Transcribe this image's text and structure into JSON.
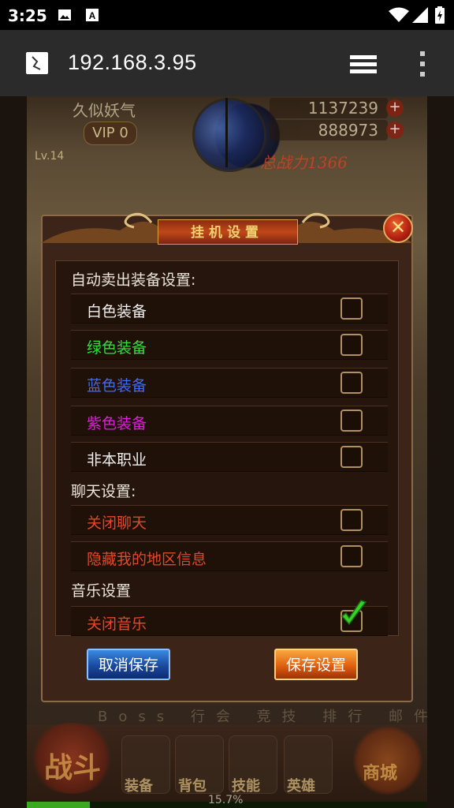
{
  "status_bar": {
    "time": "3:25",
    "icons": [
      "image-icon",
      "font-icon",
      "wifi-icon",
      "signal-icon",
      "battery-icon"
    ]
  },
  "browser": {
    "url": "192.168.3.95",
    "favicon": "page-favicon-icon",
    "tabs_icon": "tabs-icon",
    "menu_icon": "overflow-menu-icon"
  },
  "game_hud": {
    "player_name": "久似妖气",
    "vip": "VIP 0",
    "level": "Lv.14",
    "gold": "1137239",
    "gems": "888973",
    "combat_power": "总战力1366"
  },
  "dialog": {
    "title": "挂机设置",
    "sections": [
      {
        "label": "自动卖出装备设置:",
        "items": [
          {
            "label": "白色装备",
            "color": "#f0f0f0",
            "checked": false
          },
          {
            "label": "绿色装备",
            "color": "#2ee03a",
            "checked": false
          },
          {
            "label": "蓝色装备",
            "color": "#3a6aff",
            "checked": false
          },
          {
            "label": "紫色装备",
            "color": "#e01ae0",
            "checked": false
          },
          {
            "label": "非本职业",
            "color": "#f0f0f0",
            "checked": false
          }
        ]
      },
      {
        "label": "聊天设置:",
        "items": [
          {
            "label": "关闭聊天",
            "color": "#e0482a",
            "checked": false
          },
          {
            "label": "隐藏我的地区信息",
            "color": "#e0482a",
            "checked": false
          }
        ]
      },
      {
        "label": "音乐设置",
        "items": [
          {
            "label": "关闭音乐",
            "color": "#e0482a",
            "checked": true
          }
        ]
      }
    ],
    "cancel_button": "取消保存",
    "save_button": "保存设置"
  },
  "bottom_menu": {
    "top_links": "Boss 行会 竞技 排行 邮件 副本",
    "fight": "战斗",
    "items": [
      "装备",
      "背包",
      "技能",
      "英雄"
    ],
    "shop": "商城",
    "exp_percent": 15.7,
    "exp_text": "15.7%"
  },
  "colors": {
    "dialog_bg": "#3c2418",
    "row_bg": "#201108",
    "checkbox_border": "#b09060",
    "check_green": "#3ad02a"
  }
}
